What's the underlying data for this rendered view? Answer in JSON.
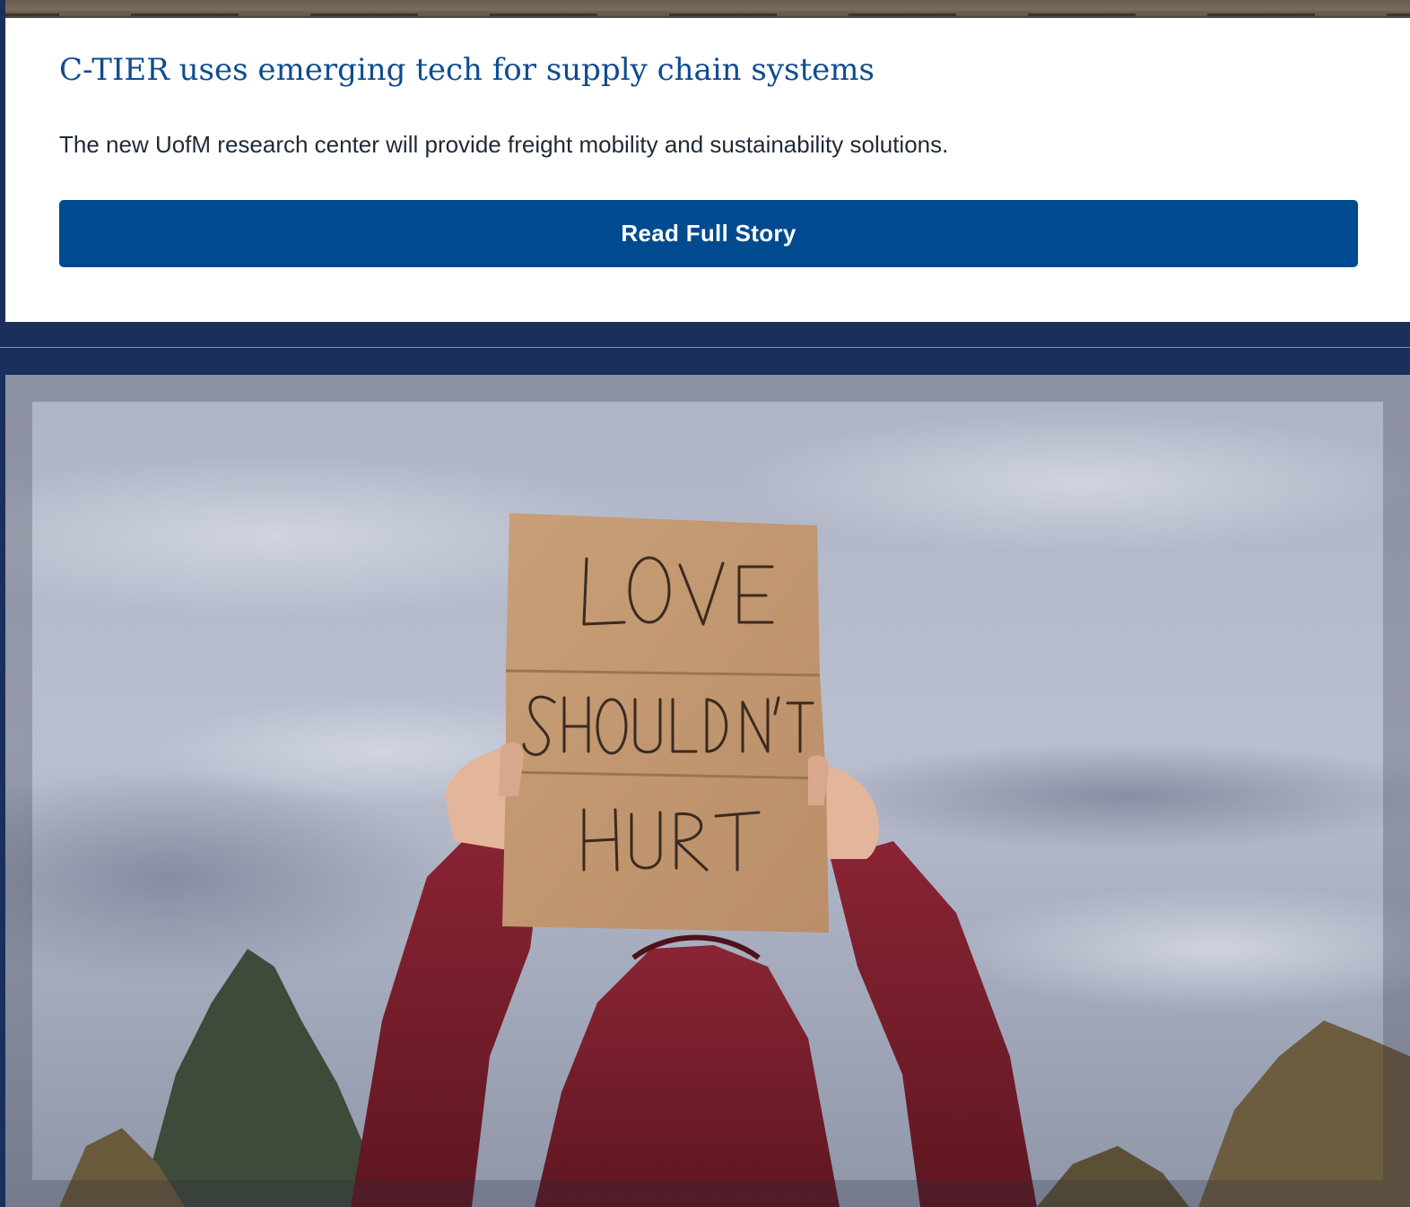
{
  "story": {
    "title": "C-TIER uses emerging tech for supply chain systems",
    "summary": "The new UofM research center will provide freight mobility and sustainability solutions.",
    "cta_label": "Read Full Story"
  },
  "hero_image": {
    "sign_lines": [
      "LOVE",
      "SHOULDN'T",
      "HURT"
    ]
  },
  "colors": {
    "page_background": "#1a2f5c",
    "title": "#0f4c8f",
    "button": "#004a8f",
    "hoodie": "#7a1e2a",
    "cardboard": "#c9a27b"
  }
}
